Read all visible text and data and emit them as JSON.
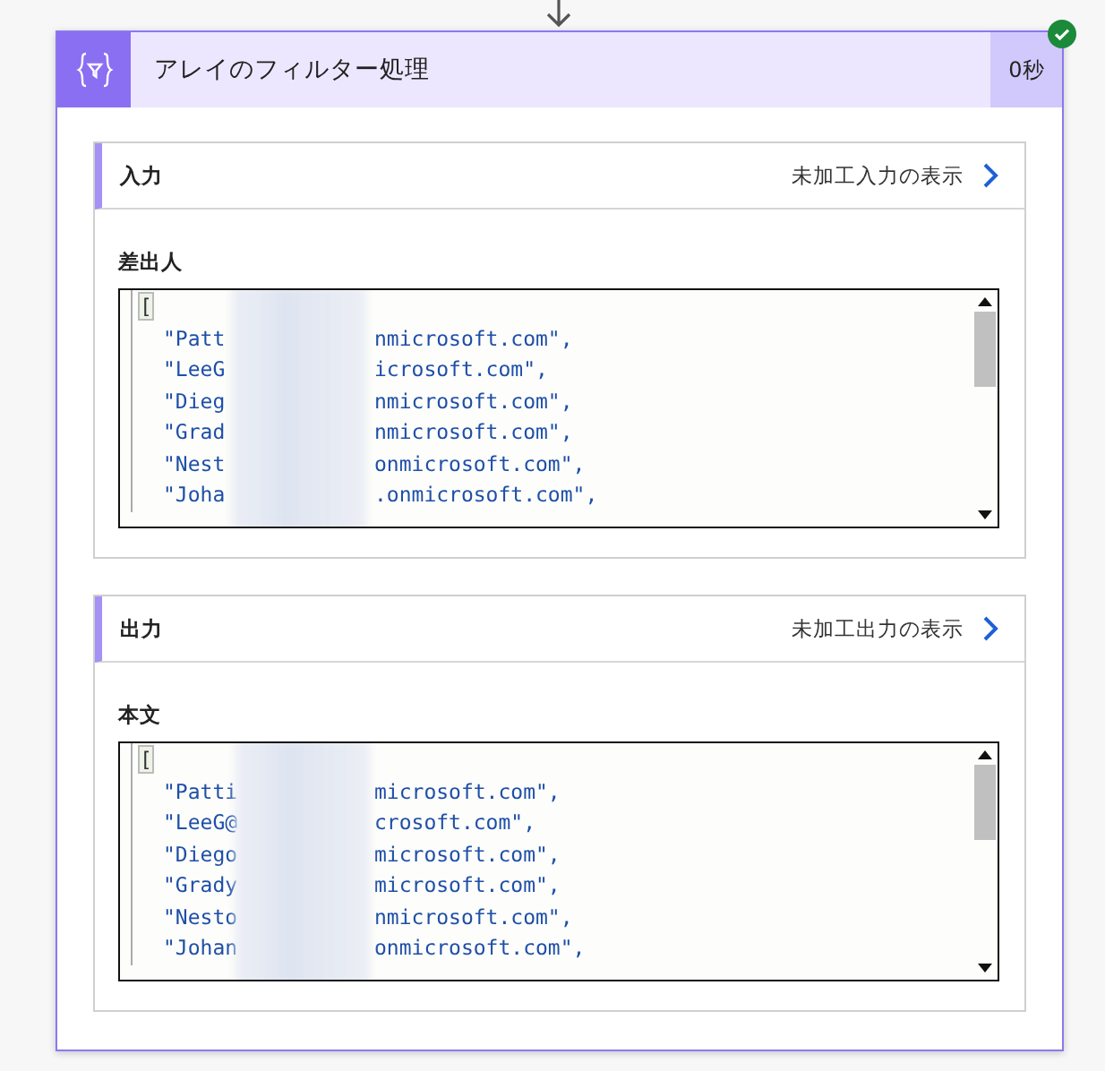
{
  "action": {
    "title": "アレイのフィルター処理",
    "duration": "0秒",
    "succeeded": true
  },
  "sections": [
    {
      "title": "入力",
      "link": "未加工入力の表示",
      "field_label": "差出人",
      "open_bracket": "[",
      "lines": [
        {
          "before": "\"Patt",
          "after": "nmicrosoft.com\","
        },
        {
          "before": "\"LeeG",
          "after": "icrosoft.com\","
        },
        {
          "before": "\"Dieg",
          "after": "nmicrosoft.com\","
        },
        {
          "before": "\"Grad",
          "after": "nmicrosoft.com\","
        },
        {
          "before": "\"Nest",
          "after": "onmicrosoft.com\","
        },
        {
          "before": "\"Joha",
          "after": ".onmicrosoft.com\","
        }
      ]
    },
    {
      "title": "出力",
      "link": "未加工出力の表示",
      "field_label": "本文",
      "open_bracket": "[",
      "lines": [
        {
          "before": "\"Patti",
          "after": "microsoft.com\","
        },
        {
          "before": "\"LeeG@",
          "after": "crosoft.com\","
        },
        {
          "before": "\"Diego",
          "after": "microsoft.com\","
        },
        {
          "before": "\"Grady",
          "after": "microsoft.com\","
        },
        {
          "before": "\"Nesto",
          "after": "nmicrosoft.com\","
        },
        {
          "before": "\"Johan",
          "after": "onmicrosoft.com\","
        }
      ]
    }
  ]
}
